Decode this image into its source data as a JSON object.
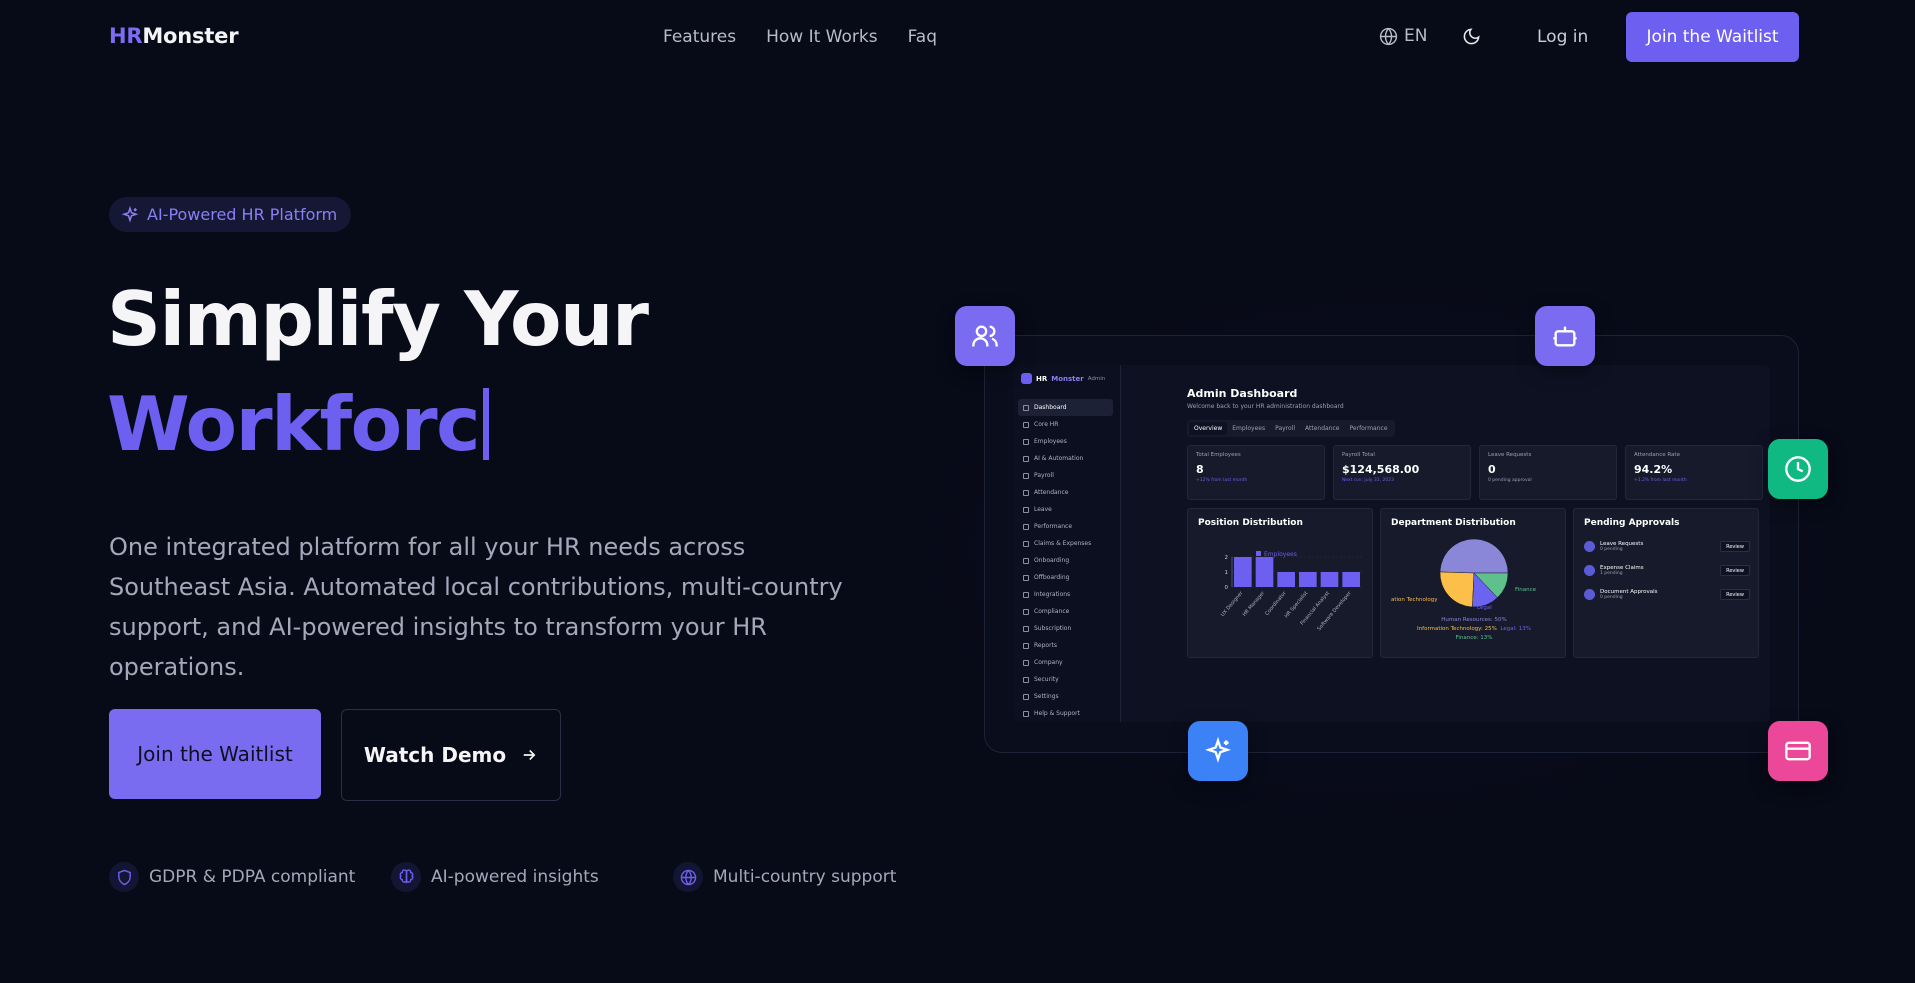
{
  "nav": {
    "logo_hr": "HR",
    "logo_monster": "Monster",
    "links": [
      "Features",
      "How It Works",
      "Faq"
    ],
    "lang": "EN",
    "login": "Log in",
    "cta": "Join the Waitlist"
  },
  "hero": {
    "badge": "AI-Powered HR Platform",
    "title_line1": "Simplify Your",
    "title_line2": "Workforc",
    "description": "One integrated platform for all your HR needs across Southeast Asia. Automated local contributions, multi-country support, and AI-powered insights to transform your HR operations.",
    "primary_button": "Join the Waitlist",
    "demo_button": "Watch Demo",
    "features": [
      "GDPR & PDPA compliant",
      "AI-powered insights",
      "Multi-country support"
    ]
  },
  "mockup": {
    "brand": "HR",
    "brand2": "Monster",
    "brand_suffix": "Admin",
    "sidebar": [
      "Dashboard",
      "Core HR",
      "Employees",
      "AI & Automation",
      "Payroll",
      "Attendance",
      "Leave",
      "Performance",
      "Claims & Expenses",
      "Onboarding",
      "Offboarding",
      "Integrations",
      "Compliance",
      "Subscription",
      "Reports",
      "Company",
      "Security",
      "Settings",
      "Help & Support"
    ],
    "title": "Admin Dashboard",
    "subtitle": "Welcome back to your HR administration dashboard",
    "tabs": [
      "Overview",
      "Employees",
      "Payroll",
      "Attendance",
      "Performance"
    ],
    "stats": [
      {
        "label": "Total Employees",
        "value": "8",
        "sub": "+12% from last month"
      },
      {
        "label": "Payroll Total",
        "value": "$124,568.00",
        "sub": "Next run: July 31, 2023"
      },
      {
        "label": "Leave Requests",
        "value": "0",
        "sub": "0 pending approval"
      },
      {
        "label": "Attendance Rate",
        "value": "94.2%",
        "sub": "+1.2% from last month"
      }
    ],
    "cards": {
      "position": "Position Distribution",
      "department": "Department Distribution",
      "pending": "Pending Approvals"
    },
    "pending": [
      {
        "title": "Leave Requests",
        "sub": "0 pending",
        "action": "Review"
      },
      {
        "title": "Expense Claims",
        "sub": "1 pending",
        "action": "Review"
      },
      {
        "title": "Document Approvals",
        "sub": "0 pending",
        "action": "Review"
      }
    ],
    "pie_labels": {
      "it": "ation Technology",
      "finance": "Finance",
      "legal": "Legal",
      "l1": "Human Resources: 50%",
      "l2": "Information Technology: 25%",
      "l3": "Legal: 13%",
      "l4": "Finance: 13%"
    }
  },
  "chart_data": [
    {
      "type": "bar",
      "title": "Position Distribution",
      "categories": [
        "UX Designer",
        "HR Manager",
        "Coordinator",
        "HR Specialist",
        "Financial Analyst",
        "Software Developer"
      ],
      "series": [
        {
          "name": "Employees",
          "values": [
            2,
            2,
            1,
            1,
            1,
            1
          ]
        }
      ],
      "ylim": [
        0,
        2
      ],
      "yticks": [
        "0",
        "1",
        "2"
      ],
      "color": "#6d5ff0"
    },
    {
      "type": "pie",
      "title": "Department Distribution",
      "categories": [
        "Human Resources",
        "Information Technology",
        "Legal",
        "Finance"
      ],
      "values": [
        50,
        25,
        13,
        13
      ],
      "colors": [
        "#8b87d8",
        "#fbbf4a",
        "#6c63f0",
        "#5ec08c"
      ]
    }
  ],
  "colors": {
    "accent": "#6d5ff0",
    "background": "#070a17",
    "float_users": "#7a6cf0",
    "float_bot": "#7a6cf0",
    "float_clock": "#10b981",
    "float_spark": "#3b82f6",
    "float_card": "#ec4899"
  }
}
